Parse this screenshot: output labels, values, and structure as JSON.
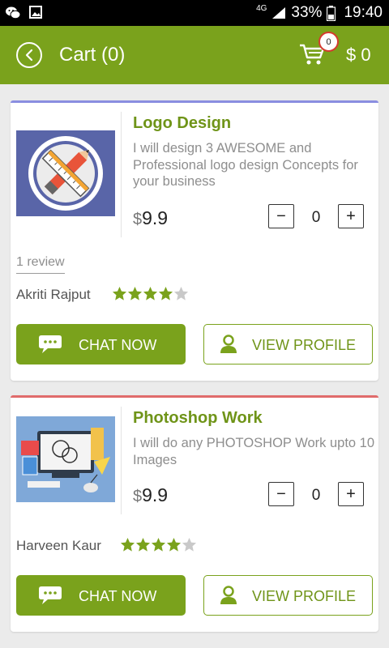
{
  "status_bar": {
    "network": "4G",
    "battery_percent": "33%",
    "time": "19:40"
  },
  "app_bar": {
    "title": "Cart (0)",
    "cart_badge": "0",
    "cart_total": "$ 0"
  },
  "colors": {
    "primary": "#7aa21c",
    "title_green": "#6f9418",
    "star_filled": "#7aa21c",
    "star_empty": "#c9c9c9",
    "card1_accent": "#8a8ee0",
    "card2_accent": "#e06b6b",
    "badge_border": "#d43b2f"
  },
  "cards": [
    {
      "title": "Logo Design",
      "description": "I will design 3 AWESOME and Professional logo design Concepts for your business",
      "currency": "$",
      "price": "9.9",
      "quantity": "0",
      "minus": "−",
      "plus": "+",
      "reviews": "1 review",
      "seller": "Akriti Rajput",
      "rating": 4,
      "rating_max": 5,
      "chat_label": "CHAT NOW",
      "profile_label": "VIEW PROFILE",
      "thumb_icon": "pencil-ruler-icon"
    },
    {
      "title": "Photoshop Work",
      "description": "I will do any PHOTOSHOP Work upto 10 Images",
      "currency": "$",
      "price": "9.9",
      "quantity": "0",
      "minus": "−",
      "plus": "+",
      "seller": "Harveen Kaur",
      "rating": 4,
      "rating_max": 5,
      "chat_label": "CHAT NOW",
      "profile_label": "VIEW PROFILE",
      "thumb_icon": "design-workspace-icon"
    }
  ]
}
